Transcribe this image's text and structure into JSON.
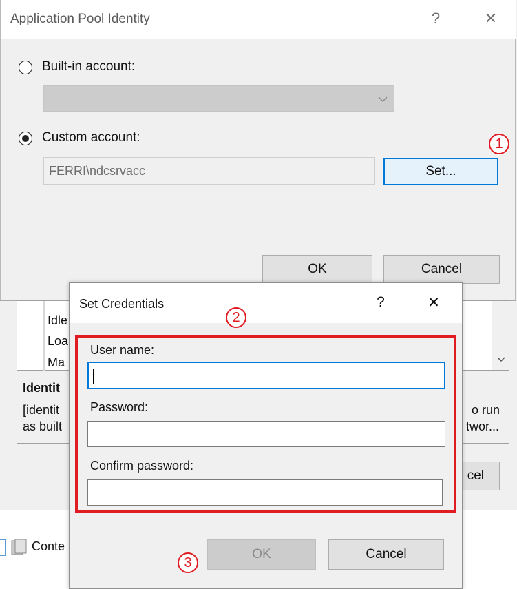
{
  "app_dialog": {
    "title": "Application Pool Identity",
    "help_glyph": "?",
    "close_glyph": "✕",
    "builtin_label": "Built-in account:",
    "custom_label": "Custom account:",
    "custom_value": "FERRI\\ndcsrvacc",
    "set_button": "Set...",
    "ok_button": "OK",
    "cancel_button": "Cancel",
    "selected_option": "custom"
  },
  "background_panel": {
    "rows": [
      "Idle",
      "Loa",
      "Ma"
    ],
    "identity_heading": "Identit",
    "identity_line1": "[identit",
    "identity_line2": "as built",
    "right_line1": "o run",
    "right_line2": "twor...",
    "right_button": "cel",
    "bottom_item": "Conte"
  },
  "cred_dialog": {
    "title": "Set Credentials",
    "help_glyph": "?",
    "close_glyph": "✕",
    "username_label": "User name:",
    "username_value": "",
    "password_label": "Password:",
    "confirm_label": "Confirm password:",
    "ok_button": "OK",
    "cancel_button": "Cancel"
  },
  "markers": [
    "1",
    "2",
    "3"
  ],
  "colors": {
    "marker_red": "#e11b22",
    "focus_blue": "#0078d7"
  }
}
